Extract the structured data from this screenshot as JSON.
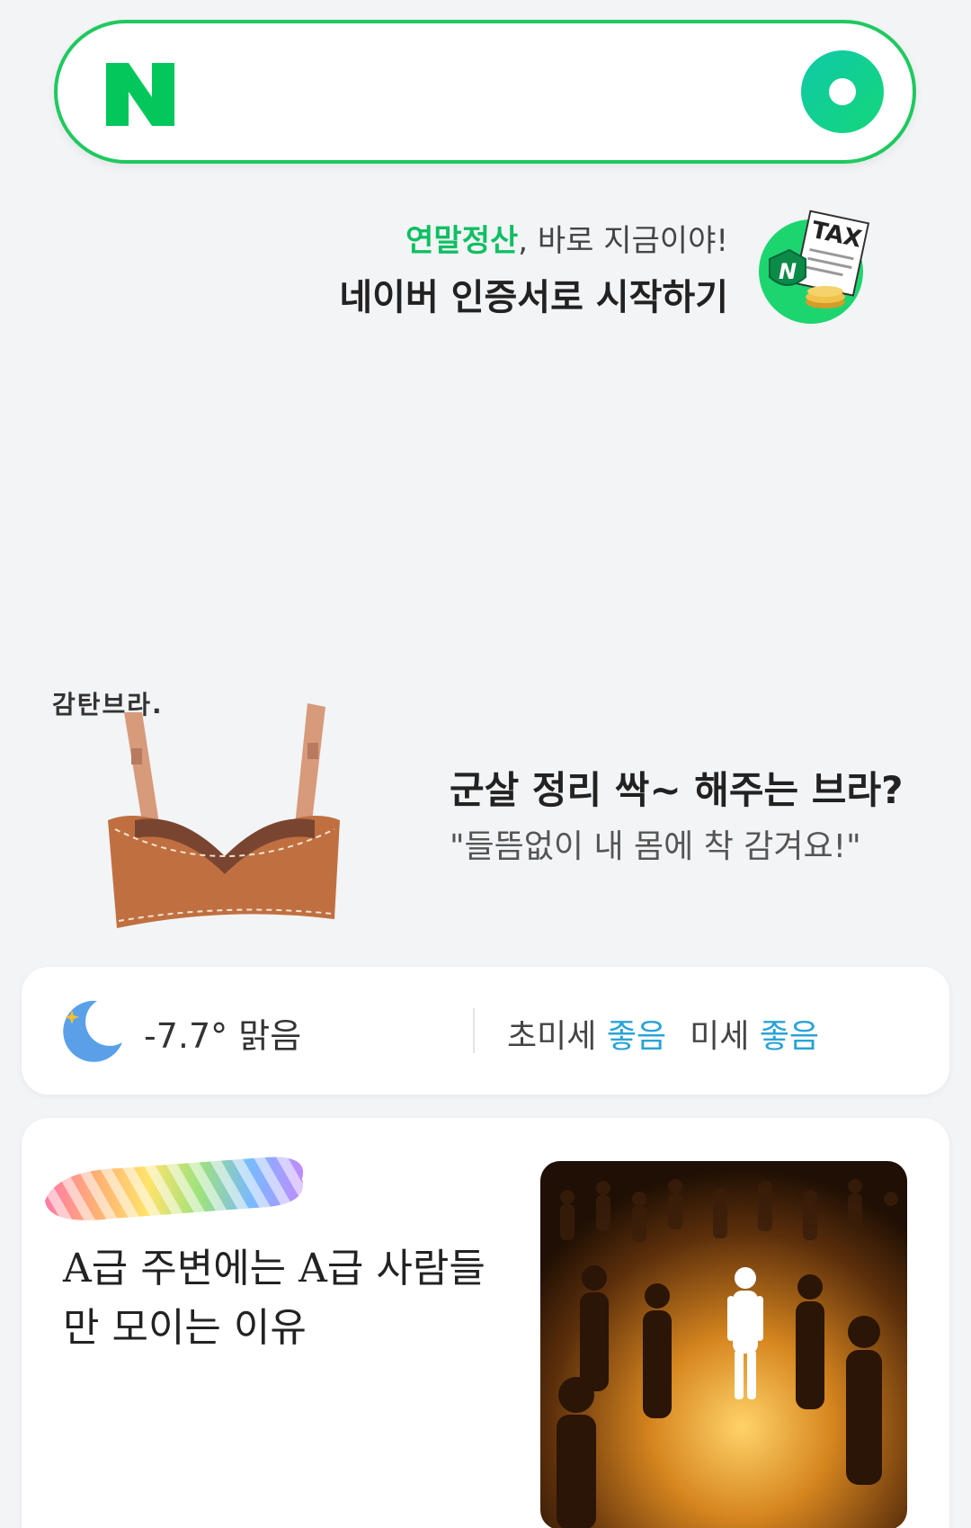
{
  "search": {
    "placeholder": ""
  },
  "tax_promo": {
    "accent": "연말정산",
    "line1_rest": ", 바로 지금이야!",
    "line2": "네이버 인증서로 시작하기",
    "icon_label": "TAX"
  },
  "ad": {
    "brand": "감탄브라.",
    "title": "군살 정리 싹~ 해주는 브라?",
    "subtitle": "\"들뜸없이 내 몸에 착 감겨요!\""
  },
  "weather": {
    "temperature": "-7.7°",
    "condition": "맑음",
    "ultrafine_label": "초미세",
    "ultrafine_value": "좋음",
    "fine_label": "미세",
    "fine_value": "좋음"
  },
  "news": {
    "title": "A급 주변에는 A급 사람들만 모이는 이유"
  },
  "colors": {
    "brand_green": "#03c75a",
    "accent_green": "#0fbf63",
    "good_blue": "#2aa3d6"
  }
}
